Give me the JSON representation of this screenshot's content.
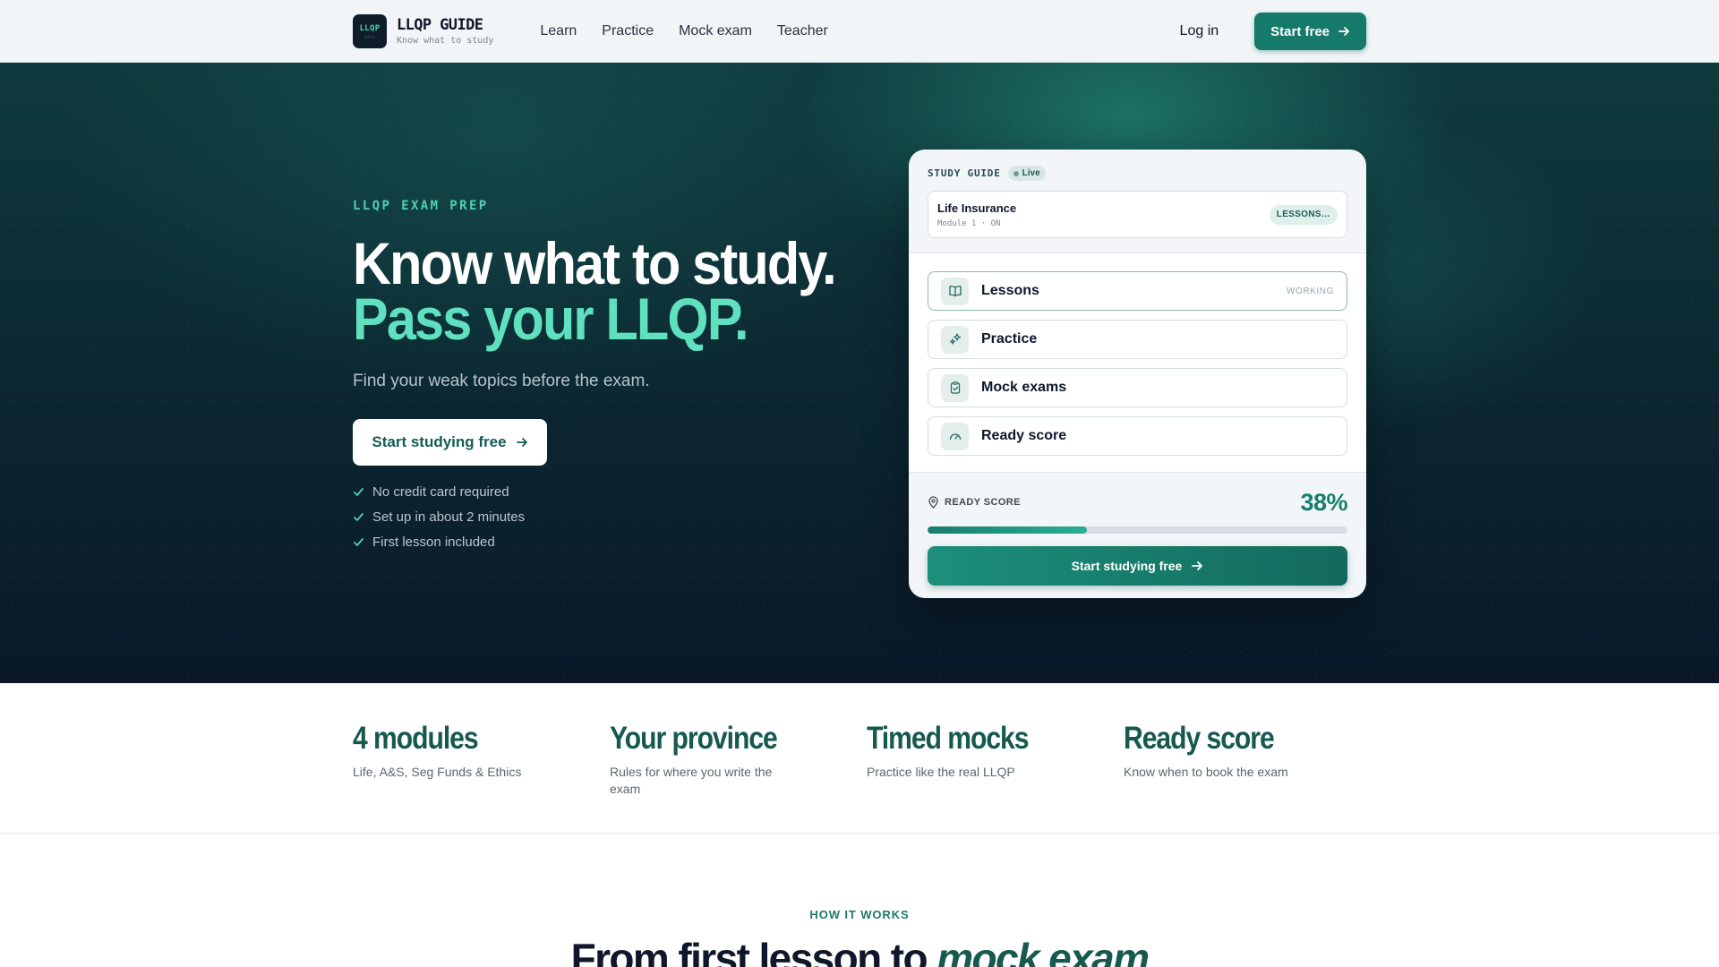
{
  "brand": {
    "logo_text": "LLQP",
    "logo_subtext": "GUIDE",
    "name": "LLQP GUIDE",
    "tagline": "Know what to study"
  },
  "nav": {
    "links": [
      "Learn",
      "Practice",
      "Mock exam",
      "Teacher"
    ],
    "login": "Log in",
    "start_free": "Start free"
  },
  "hero": {
    "eyebrow": "LLQP EXAM PREP",
    "headline_line1": "Know what to study.",
    "headline_line2": "Pass your LLQP.",
    "subheadline": "Find your weak topics before the exam.",
    "cta": "Start studying free",
    "checks": [
      "No credit card required",
      "Set up in about 2 minutes",
      "First lesson included"
    ]
  },
  "card": {
    "label": "STUDY GUIDE",
    "live": "Live",
    "course_title": "Life Insurance",
    "course_meta": "Module 1 · ON",
    "course_pill": "LESSONS…",
    "rows": [
      {
        "label": "Lessons",
        "status": "WORKING",
        "icon": "book-icon"
      },
      {
        "label": "Practice",
        "status": "",
        "icon": "sparkle-icon"
      },
      {
        "label": "Mock exams",
        "status": "",
        "icon": "clipboard-check-icon"
      },
      {
        "label": "Ready score",
        "status": "",
        "icon": "gauge-icon"
      }
    ],
    "ready_label": "READY SCORE",
    "ready_value": "38%",
    "ready_fraction": 0.38,
    "cta": "Start studying free"
  },
  "stats": [
    {
      "title": "4 modules",
      "desc": "Life, A&S, Seg Funds & Ethics"
    },
    {
      "title": "Your province",
      "desc": "Rules for where you write the exam"
    },
    {
      "title": "Timed mocks",
      "desc": "Practice like the real LLQP"
    },
    {
      "title": "Ready score",
      "desc": "Know when to book the exam"
    }
  ],
  "how": {
    "eyebrow": "HOW IT WORKS",
    "title_start": "From first lesson to ",
    "title_em": "mock exam"
  },
  "colors": {
    "accent": "#167a6a",
    "accent_light": "#5fe0bf",
    "hero_dark": "#0a1828"
  }
}
